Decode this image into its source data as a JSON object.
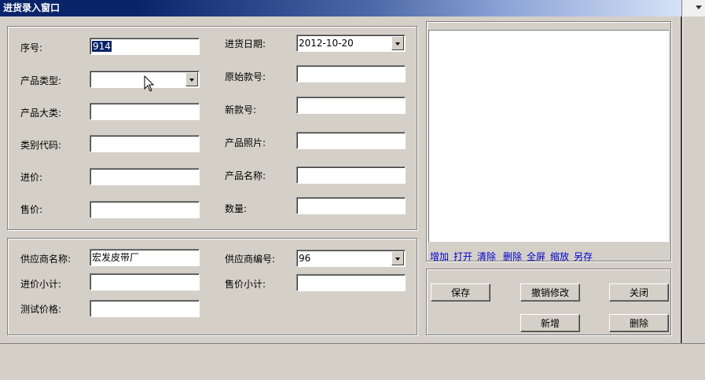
{
  "window": {
    "title": "进货录入窗口"
  },
  "product_form": {
    "serial_label": "序号:",
    "serial_value": "914",
    "product_type_label": "产品类型:",
    "product_type_value": "",
    "category_label": "产品大类:",
    "category_value": "",
    "category_code_label": "类别代码:",
    "category_code_value": "",
    "purchase_price_label": "进价:",
    "purchase_price_value": "",
    "sale_price_label": "售价:",
    "sale_price_value": "",
    "date_label": "进货日期:",
    "date_value": "2012-10-20",
    "original_model_label": "原始款号:",
    "original_model_value": "",
    "new_model_label": "新款号:",
    "new_model_value": "",
    "photo_label": "产品照片:",
    "photo_value": "",
    "product_name_label": "产品名称:",
    "product_name_value": "",
    "quantity_label": "数量:",
    "quantity_value": ""
  },
  "supplier_form": {
    "supplier_name_label": "供应商名称:",
    "supplier_name_value": "宏发皮带厂",
    "supplier_code_label": "供应商编号:",
    "supplier_code_value": "96",
    "purchase_subtotal_label": "进价小计:",
    "purchase_subtotal_value": "",
    "sale_subtotal_label": "售价小计:",
    "sale_subtotal_value": "",
    "test_price_label": "测试价格:",
    "test_price_value": ""
  },
  "image_panel": {
    "actions": [
      "增加",
      "打开",
      "清除",
      "删除",
      "全屏",
      "缩放",
      "另存"
    ]
  },
  "buttons": {
    "save": "保存",
    "undo": "撤销修改",
    "close": "关闭",
    "new": "新增",
    "delete": "删除"
  },
  "colors": {
    "selection": "#0a246a",
    "link": "#0000cc",
    "titlebar": "#0a246a"
  }
}
